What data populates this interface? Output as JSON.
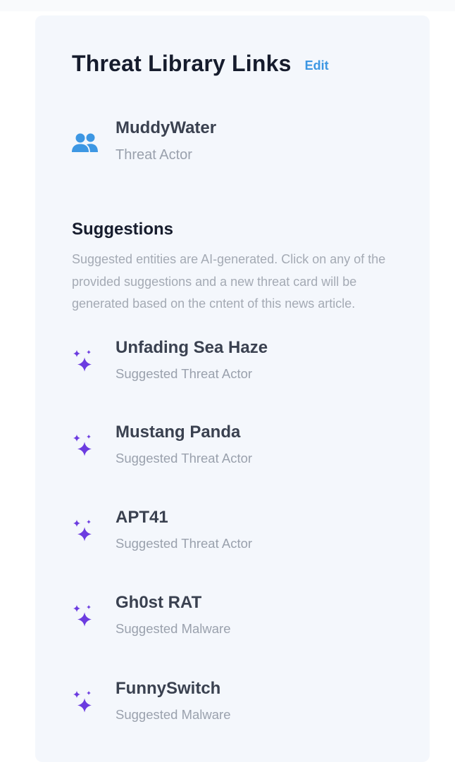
{
  "panel": {
    "title": "Threat Library Links",
    "edit_label": "Edit"
  },
  "linked_entities": [
    {
      "name": "MuddyWater",
      "type": "Threat Actor",
      "icon": "users-icon"
    }
  ],
  "suggestions": {
    "title": "Suggestions",
    "description": "Suggested entities are AI-generated. Click on any of the provided suggestions and a new threat card will be generated based on the cntent of this news article.",
    "items": [
      {
        "name": "Unfading Sea Haze",
        "type": "Suggested Threat Actor",
        "icon": "sparkles-icon"
      },
      {
        "name": "Mustang Panda",
        "type": "Suggested Threat Actor",
        "icon": "sparkles-icon"
      },
      {
        "name": "APT41",
        "type": "Suggested Threat Actor",
        "icon": "sparkles-icon"
      },
      {
        "name": "Gh0st RAT",
        "type": "Suggested Malware",
        "icon": "sparkles-icon"
      },
      {
        "name": "FunnySwitch",
        "type": "Suggested Malware",
        "icon": "sparkles-icon"
      }
    ]
  },
  "colors": {
    "panel_bg": "#f4f7fc",
    "title": "#161c2d",
    "link": "#3d97e3",
    "entity_name": "#3a4150",
    "muted": "#9aa1ad",
    "users_icon": "#3d97e3",
    "sparkles_icon": "#6c3ce0"
  }
}
